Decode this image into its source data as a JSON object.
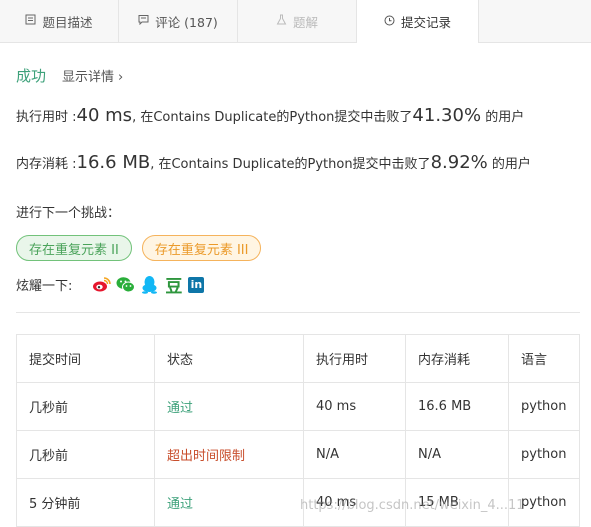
{
  "tabs": [
    {
      "label": "题目描述",
      "icon": "document-icon"
    },
    {
      "label": "评论 (187)",
      "icon": "comment-icon"
    },
    {
      "label": "题解",
      "icon": "flask-icon"
    },
    {
      "label": "提交记录",
      "icon": "clock-icon"
    }
  ],
  "result": {
    "status": "成功",
    "details": "显示详情",
    "details_arrow": "›"
  },
  "runtime": {
    "label": "执行用时 :",
    "value": "40 ms",
    "middle": ", 在Contains Duplicate的Python提交中击败了",
    "pct": "41.30%",
    "suffix": " 的用户"
  },
  "memory": {
    "label": "内存消耗 :",
    "value": "16.6 MB",
    "middle": ", 在Contains Duplicate的Python提交中击败了",
    "pct": "8.92%",
    "suffix": " 的用户"
  },
  "next": {
    "heading": "进行下一个挑战：",
    "items": [
      "存在重复元素 II",
      "存在重复元素 III"
    ]
  },
  "share": {
    "label": "炫耀一下:",
    "icons": [
      "weibo-icon",
      "wechat-icon",
      "qq-icon",
      "douban-icon",
      "linkedin-icon"
    ],
    "douban": "豆",
    "linkedin": "in"
  },
  "table": {
    "headers": [
      "提交时间",
      "状态",
      "执行用时",
      "内存消耗",
      "语言"
    ],
    "rows": [
      {
        "time": "几秒前",
        "status": "通过",
        "runtime": "40 ms",
        "memory": "16.6 MB",
        "lang": "python"
      },
      {
        "time": "几秒前",
        "status": "超出时间限制",
        "runtime": "N/A",
        "memory": "N/A",
        "lang": "python"
      },
      {
        "time": "5 分钟前",
        "status": "通过",
        "runtime": "40 ms",
        "memory": "15 MB",
        "lang": "python"
      }
    ]
  },
  "watermark": "https://blog.csdn.net/weixin_4...11",
  "colors": {
    "success": "#3da17a",
    "error": "#c84e2c",
    "green_pill": "#4aa35a",
    "orange_pill": "#eb9a2a"
  }
}
